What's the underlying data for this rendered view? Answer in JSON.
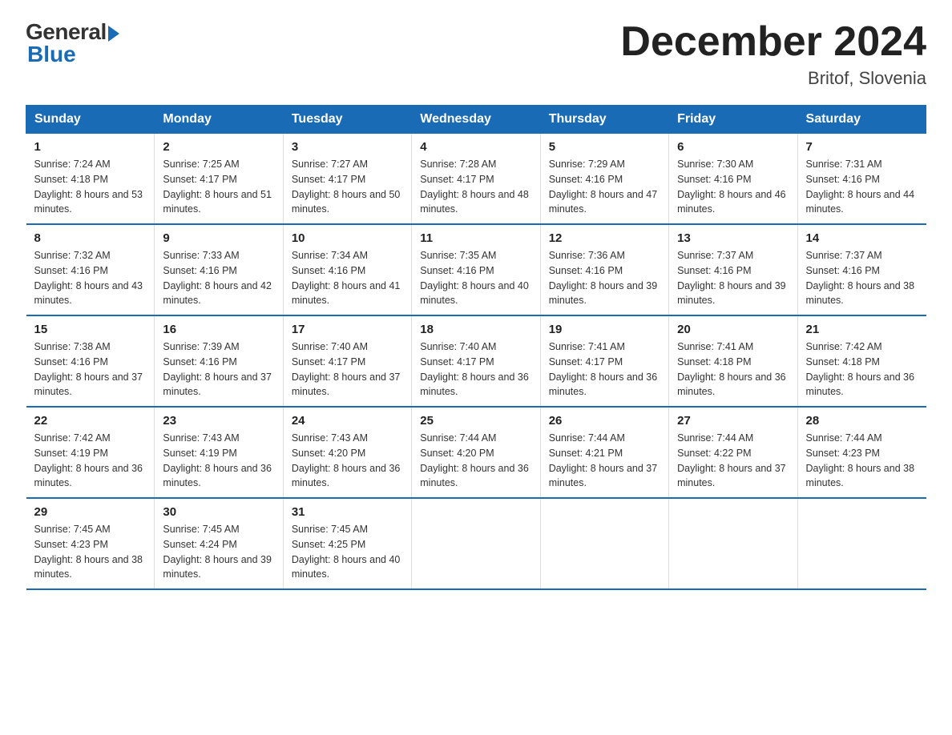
{
  "header": {
    "logo_general": "General",
    "logo_blue": "Blue",
    "month_title": "December 2024",
    "location": "Britof, Slovenia"
  },
  "weekdays": [
    "Sunday",
    "Monday",
    "Tuesday",
    "Wednesday",
    "Thursday",
    "Friday",
    "Saturday"
  ],
  "weeks": [
    [
      {
        "day": "1",
        "sunrise": "7:24 AM",
        "sunset": "4:18 PM",
        "daylight": "8 hours and 53 minutes."
      },
      {
        "day": "2",
        "sunrise": "7:25 AM",
        "sunset": "4:17 PM",
        "daylight": "8 hours and 51 minutes."
      },
      {
        "day": "3",
        "sunrise": "7:27 AM",
        "sunset": "4:17 PM",
        "daylight": "8 hours and 50 minutes."
      },
      {
        "day": "4",
        "sunrise": "7:28 AM",
        "sunset": "4:17 PM",
        "daylight": "8 hours and 48 minutes."
      },
      {
        "day": "5",
        "sunrise": "7:29 AM",
        "sunset": "4:16 PM",
        "daylight": "8 hours and 47 minutes."
      },
      {
        "day": "6",
        "sunrise": "7:30 AM",
        "sunset": "4:16 PM",
        "daylight": "8 hours and 46 minutes."
      },
      {
        "day": "7",
        "sunrise": "7:31 AM",
        "sunset": "4:16 PM",
        "daylight": "8 hours and 44 minutes."
      }
    ],
    [
      {
        "day": "8",
        "sunrise": "7:32 AM",
        "sunset": "4:16 PM",
        "daylight": "8 hours and 43 minutes."
      },
      {
        "day": "9",
        "sunrise": "7:33 AM",
        "sunset": "4:16 PM",
        "daylight": "8 hours and 42 minutes."
      },
      {
        "day": "10",
        "sunrise": "7:34 AM",
        "sunset": "4:16 PM",
        "daylight": "8 hours and 41 minutes."
      },
      {
        "day": "11",
        "sunrise": "7:35 AM",
        "sunset": "4:16 PM",
        "daylight": "8 hours and 40 minutes."
      },
      {
        "day": "12",
        "sunrise": "7:36 AM",
        "sunset": "4:16 PM",
        "daylight": "8 hours and 39 minutes."
      },
      {
        "day": "13",
        "sunrise": "7:37 AM",
        "sunset": "4:16 PM",
        "daylight": "8 hours and 39 minutes."
      },
      {
        "day": "14",
        "sunrise": "7:37 AM",
        "sunset": "4:16 PM",
        "daylight": "8 hours and 38 minutes."
      }
    ],
    [
      {
        "day": "15",
        "sunrise": "7:38 AM",
        "sunset": "4:16 PM",
        "daylight": "8 hours and 37 minutes."
      },
      {
        "day": "16",
        "sunrise": "7:39 AM",
        "sunset": "4:16 PM",
        "daylight": "8 hours and 37 minutes."
      },
      {
        "day": "17",
        "sunrise": "7:40 AM",
        "sunset": "4:17 PM",
        "daylight": "8 hours and 37 minutes."
      },
      {
        "day": "18",
        "sunrise": "7:40 AM",
        "sunset": "4:17 PM",
        "daylight": "8 hours and 36 minutes."
      },
      {
        "day": "19",
        "sunrise": "7:41 AM",
        "sunset": "4:17 PM",
        "daylight": "8 hours and 36 minutes."
      },
      {
        "day": "20",
        "sunrise": "7:41 AM",
        "sunset": "4:18 PM",
        "daylight": "8 hours and 36 minutes."
      },
      {
        "day": "21",
        "sunrise": "7:42 AM",
        "sunset": "4:18 PM",
        "daylight": "8 hours and 36 minutes."
      }
    ],
    [
      {
        "day": "22",
        "sunrise": "7:42 AM",
        "sunset": "4:19 PM",
        "daylight": "8 hours and 36 minutes."
      },
      {
        "day": "23",
        "sunrise": "7:43 AM",
        "sunset": "4:19 PM",
        "daylight": "8 hours and 36 minutes."
      },
      {
        "day": "24",
        "sunrise": "7:43 AM",
        "sunset": "4:20 PM",
        "daylight": "8 hours and 36 minutes."
      },
      {
        "day": "25",
        "sunrise": "7:44 AM",
        "sunset": "4:20 PM",
        "daylight": "8 hours and 36 minutes."
      },
      {
        "day": "26",
        "sunrise": "7:44 AM",
        "sunset": "4:21 PM",
        "daylight": "8 hours and 37 minutes."
      },
      {
        "day": "27",
        "sunrise": "7:44 AM",
        "sunset": "4:22 PM",
        "daylight": "8 hours and 37 minutes."
      },
      {
        "day": "28",
        "sunrise": "7:44 AM",
        "sunset": "4:23 PM",
        "daylight": "8 hours and 38 minutes."
      }
    ],
    [
      {
        "day": "29",
        "sunrise": "7:45 AM",
        "sunset": "4:23 PM",
        "daylight": "8 hours and 38 minutes."
      },
      {
        "day": "30",
        "sunrise": "7:45 AM",
        "sunset": "4:24 PM",
        "daylight": "8 hours and 39 minutes."
      },
      {
        "day": "31",
        "sunrise": "7:45 AM",
        "sunset": "4:25 PM",
        "daylight": "8 hours and 40 minutes."
      },
      null,
      null,
      null,
      null
    ]
  ]
}
